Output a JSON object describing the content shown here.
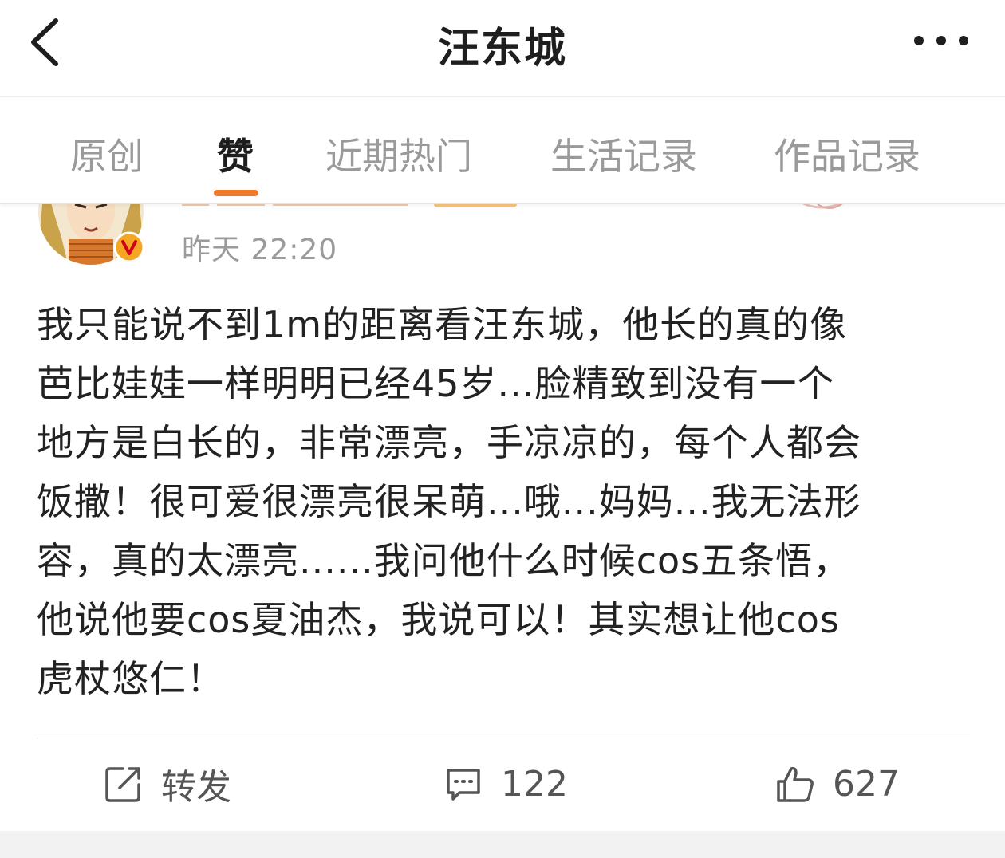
{
  "header": {
    "title": "汪东城",
    "back_icon": "chevron-left-icon",
    "more_icon": "more-horizontal-icon"
  },
  "tabs": [
    {
      "label": "原创",
      "active": false
    },
    {
      "label": "赞",
      "active": true
    },
    {
      "label": "近期热门",
      "active": false
    },
    {
      "label": "生活记录",
      "active": false
    },
    {
      "label": "作品记录",
      "active": false
    }
  ],
  "colors": {
    "accent": "#f07a2a",
    "verified_badge": "#f5a623",
    "tab_inactive": "#9a9a9a",
    "text": "#222222"
  },
  "post": {
    "timestamp": "昨天 22:20",
    "lines": [
      "我只能说不到1m的距离看汪东城，他长的真的像",
      "芭比娃娃一样明明已经45岁...脸精致到没有一个",
      "地方是白长的，非常漂亮，手凉凉的，每个人都会",
      "饭撒！很可爱很漂亮很呆萌...哦...妈妈...我无法形",
      "容，真的太漂亮......我问他什么时候cos五条悟，",
      "他说他要cos夏油杰，我说可以！其实想让他cos",
      "虎杖悠仁！"
    ]
  },
  "actions": {
    "repost": {
      "label": "转发",
      "icon": "share-icon"
    },
    "comment": {
      "count": "122",
      "icon": "comment-icon"
    },
    "like": {
      "count": "627",
      "icon": "thumbs-up-icon"
    }
  }
}
